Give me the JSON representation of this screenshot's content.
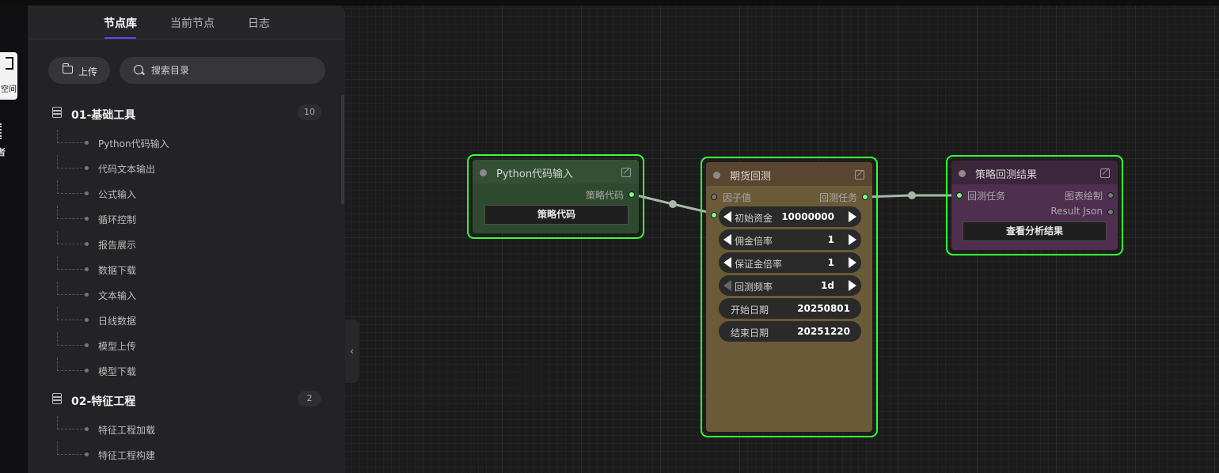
{
  "rail": {
    "active_label": "空间",
    "second_label": "者"
  },
  "tabs": [
    {
      "label": "节点库"
    },
    {
      "label": "当前节点"
    },
    {
      "label": "日志"
    }
  ],
  "toolbar": {
    "upload_label": "上传",
    "search_placeholder": "搜索目录"
  },
  "categories": [
    {
      "name": "01-基础工具",
      "count": "10",
      "items": [
        "Python代码输入",
        "代码文本输出",
        "公式输入",
        "循环控制",
        "报告展示",
        "数据下载",
        "文本输入",
        "日线数据",
        "模型上传",
        "模型下载"
      ]
    },
    {
      "name": "02-特征工程",
      "count": "2",
      "items": [
        "特征工程加载",
        "特征工程构建"
      ]
    }
  ],
  "collapse_icon": "‹",
  "nodes": {
    "python_input": {
      "title": "Python代码输入",
      "output_port": "策略代码",
      "button": "策略代码"
    },
    "futures_backtest": {
      "title": "期货回测",
      "input_port_1": "因子值",
      "output_port": "回测任务",
      "widgets": [
        {
          "label": "初始资金",
          "value": "10000000"
        },
        {
          "label": "佣金倍率",
          "value": "1"
        },
        {
          "label": "保证金倍率",
          "value": "1"
        },
        {
          "label": "回测频率",
          "value": "1d"
        },
        {
          "label": "开始日期",
          "value": "20250801"
        },
        {
          "label": "结束日期",
          "value": "20251220"
        }
      ]
    },
    "backtest_result": {
      "title": "策略回测结果",
      "input_port": "回测任务",
      "output_port_1": "图表绘制",
      "output_port_2": "Result Json",
      "button": "查看分析结果"
    }
  },
  "colors": {
    "selection": "#36ff36",
    "accent": "#5b46ff",
    "link": "#a8b8a8"
  }
}
